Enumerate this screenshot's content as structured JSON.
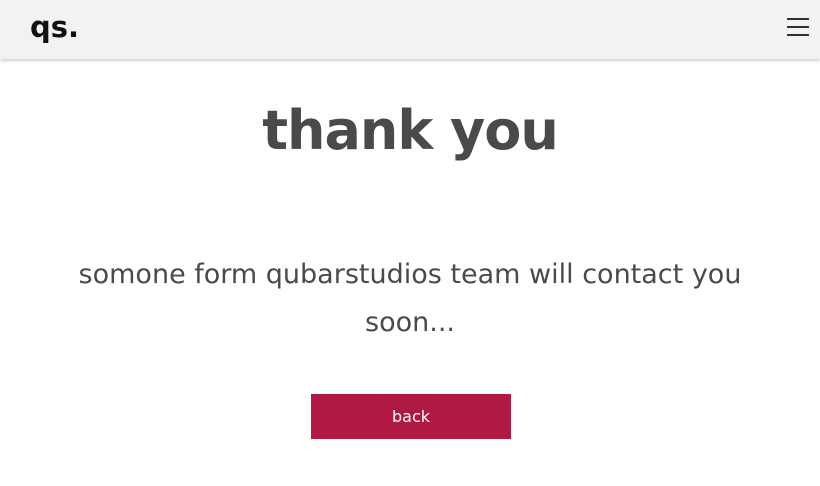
{
  "header": {
    "logo": "qs.",
    "menu_icon": "hamburger-menu-icon"
  },
  "main": {
    "title": "thank you",
    "message": "somone form qubarstudios team will contact you soon...",
    "back_label": "back"
  },
  "colors": {
    "header_bg": "#f2f2f2",
    "text": "#4a4a4a",
    "button_bg": "#b01942",
    "button_text": "#ffffff"
  }
}
